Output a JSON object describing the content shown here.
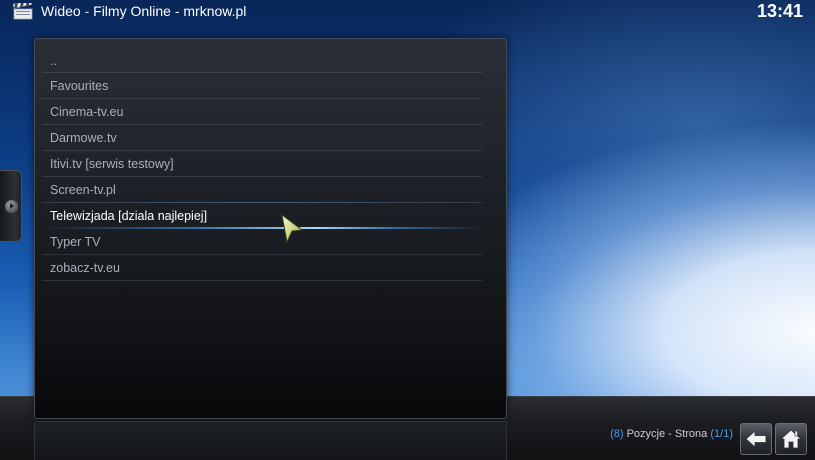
{
  "header": {
    "section": "Wideo",
    "separator": " - ",
    "path": "Filmy Online - mrknow.pl",
    "clock": "13:41"
  },
  "list": {
    "items": [
      {
        "label": ".."
      },
      {
        "label": "Favourites"
      },
      {
        "label": "Cinema-tv.eu"
      },
      {
        "label": "Darmowe.tv"
      },
      {
        "label": "Itivi.tv [serwis testowy]"
      },
      {
        "label": "Screen-tv.pl"
      },
      {
        "label": "Telewizjada [dziala najlepiej]"
      },
      {
        "label": "Typer TV"
      },
      {
        "label": "zobacz-tv.eu"
      }
    ],
    "focused_index": 6
  },
  "footer": {
    "open_paren": "(",
    "count": "8",
    "mid_text": ") Pozycje - Strona (",
    "page": "1/1",
    "close_paren": ")"
  },
  "icons": {
    "app": "clapperboard-icon",
    "back": "back-arrow-icon",
    "home": "home-icon",
    "side": "side-menu-arrow-icon"
  },
  "colors": {
    "accent": "#4b9be8",
    "focus_text": "#ffffff",
    "item_text": "#a9b0ba"
  }
}
